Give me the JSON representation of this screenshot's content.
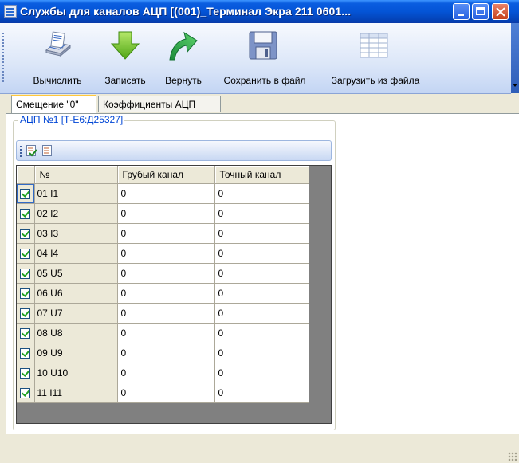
{
  "window": {
    "title": "Службы для каналов АЦП  [(001)_Терминал Экра 211 0601..."
  },
  "toolbar": {
    "buttons": [
      {
        "label": "Вычислить",
        "icon": "calculate-icon"
      },
      {
        "label": "Записать",
        "icon": "write-down-arrow-icon"
      },
      {
        "label": "Вернуть",
        "icon": "revert-arrow-icon"
      },
      {
        "label": "Сохранить в файл",
        "icon": "save-floppy-icon"
      },
      {
        "label": "Загрузить из файла",
        "icon": "load-table-icon"
      }
    ]
  },
  "tabs": [
    {
      "label": "Смещение \"0\"",
      "active": true
    },
    {
      "label": "Коэффициенты АЦП",
      "active": false
    }
  ],
  "group": {
    "legend": "АЦП №1 [Т-Е6:Д25327]"
  },
  "grid": {
    "columns": [
      "",
      "№",
      "Грубый канал",
      "Точный канал"
    ],
    "rows": [
      {
        "checked": true,
        "name": "01 I1",
        "coarse": "0",
        "fine": "0"
      },
      {
        "checked": true,
        "name": "02 I2",
        "coarse": "0",
        "fine": "0"
      },
      {
        "checked": true,
        "name": "03 I3",
        "coarse": "0",
        "fine": "0"
      },
      {
        "checked": true,
        "name": "04 I4",
        "coarse": "0",
        "fine": "0"
      },
      {
        "checked": true,
        "name": "05 U5",
        "coarse": "0",
        "fine": "0"
      },
      {
        "checked": true,
        "name": "06 U6",
        "coarse": "0",
        "fine": "0"
      },
      {
        "checked": true,
        "name": "07 U7",
        "coarse": "0",
        "fine": "0"
      },
      {
        "checked": true,
        "name": "08 U8",
        "coarse": "0",
        "fine": "0"
      },
      {
        "checked": true,
        "name": "09 U9",
        "coarse": "0",
        "fine": "0"
      },
      {
        "checked": true,
        "name": "10 U10",
        "coarse": "0",
        "fine": "0"
      },
      {
        "checked": true,
        "name": "11 I11",
        "coarse": "0",
        "fine": "0"
      }
    ]
  },
  "colors": {
    "title_bar": "#0454d6",
    "legend_text": "#0046d5",
    "check_mark": "#21a121"
  }
}
